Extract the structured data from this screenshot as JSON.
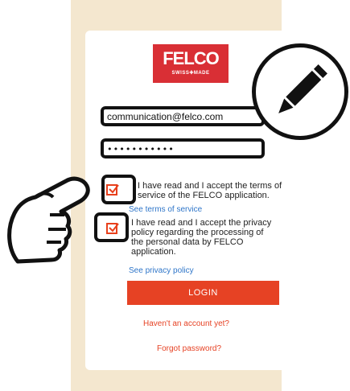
{
  "logo": {
    "brand": "FELCO",
    "tagline": "SWISS✚MADE"
  },
  "form": {
    "email_value": "communication@felco.com",
    "password_value": "•••••••••••"
  },
  "terms": {
    "text_line1": "I have read and I accept the terms of",
    "text_line2": "service of the FELCO application.",
    "link": "See terms of service",
    "checked": true
  },
  "privacy": {
    "text_line1": "I have read and I accept the privacy",
    "text_line2": "policy regarding the processing of",
    "text_line3": "the personal data by FELCO",
    "text_line4": "application.",
    "link": "See privacy policy",
    "checked": true
  },
  "actions": {
    "login_label": "LOGIN",
    "signup_label": "Haven't an account yet?",
    "forgot_label": "Forgot password?"
  },
  "colors": {
    "accent": "#e64224",
    "logo_red": "#d92f35",
    "link_blue": "#2f76c9",
    "background": "#f4e7cf"
  },
  "icons": [
    "pencil-icon",
    "pointing-hand-icon",
    "checkmark-icon"
  ]
}
